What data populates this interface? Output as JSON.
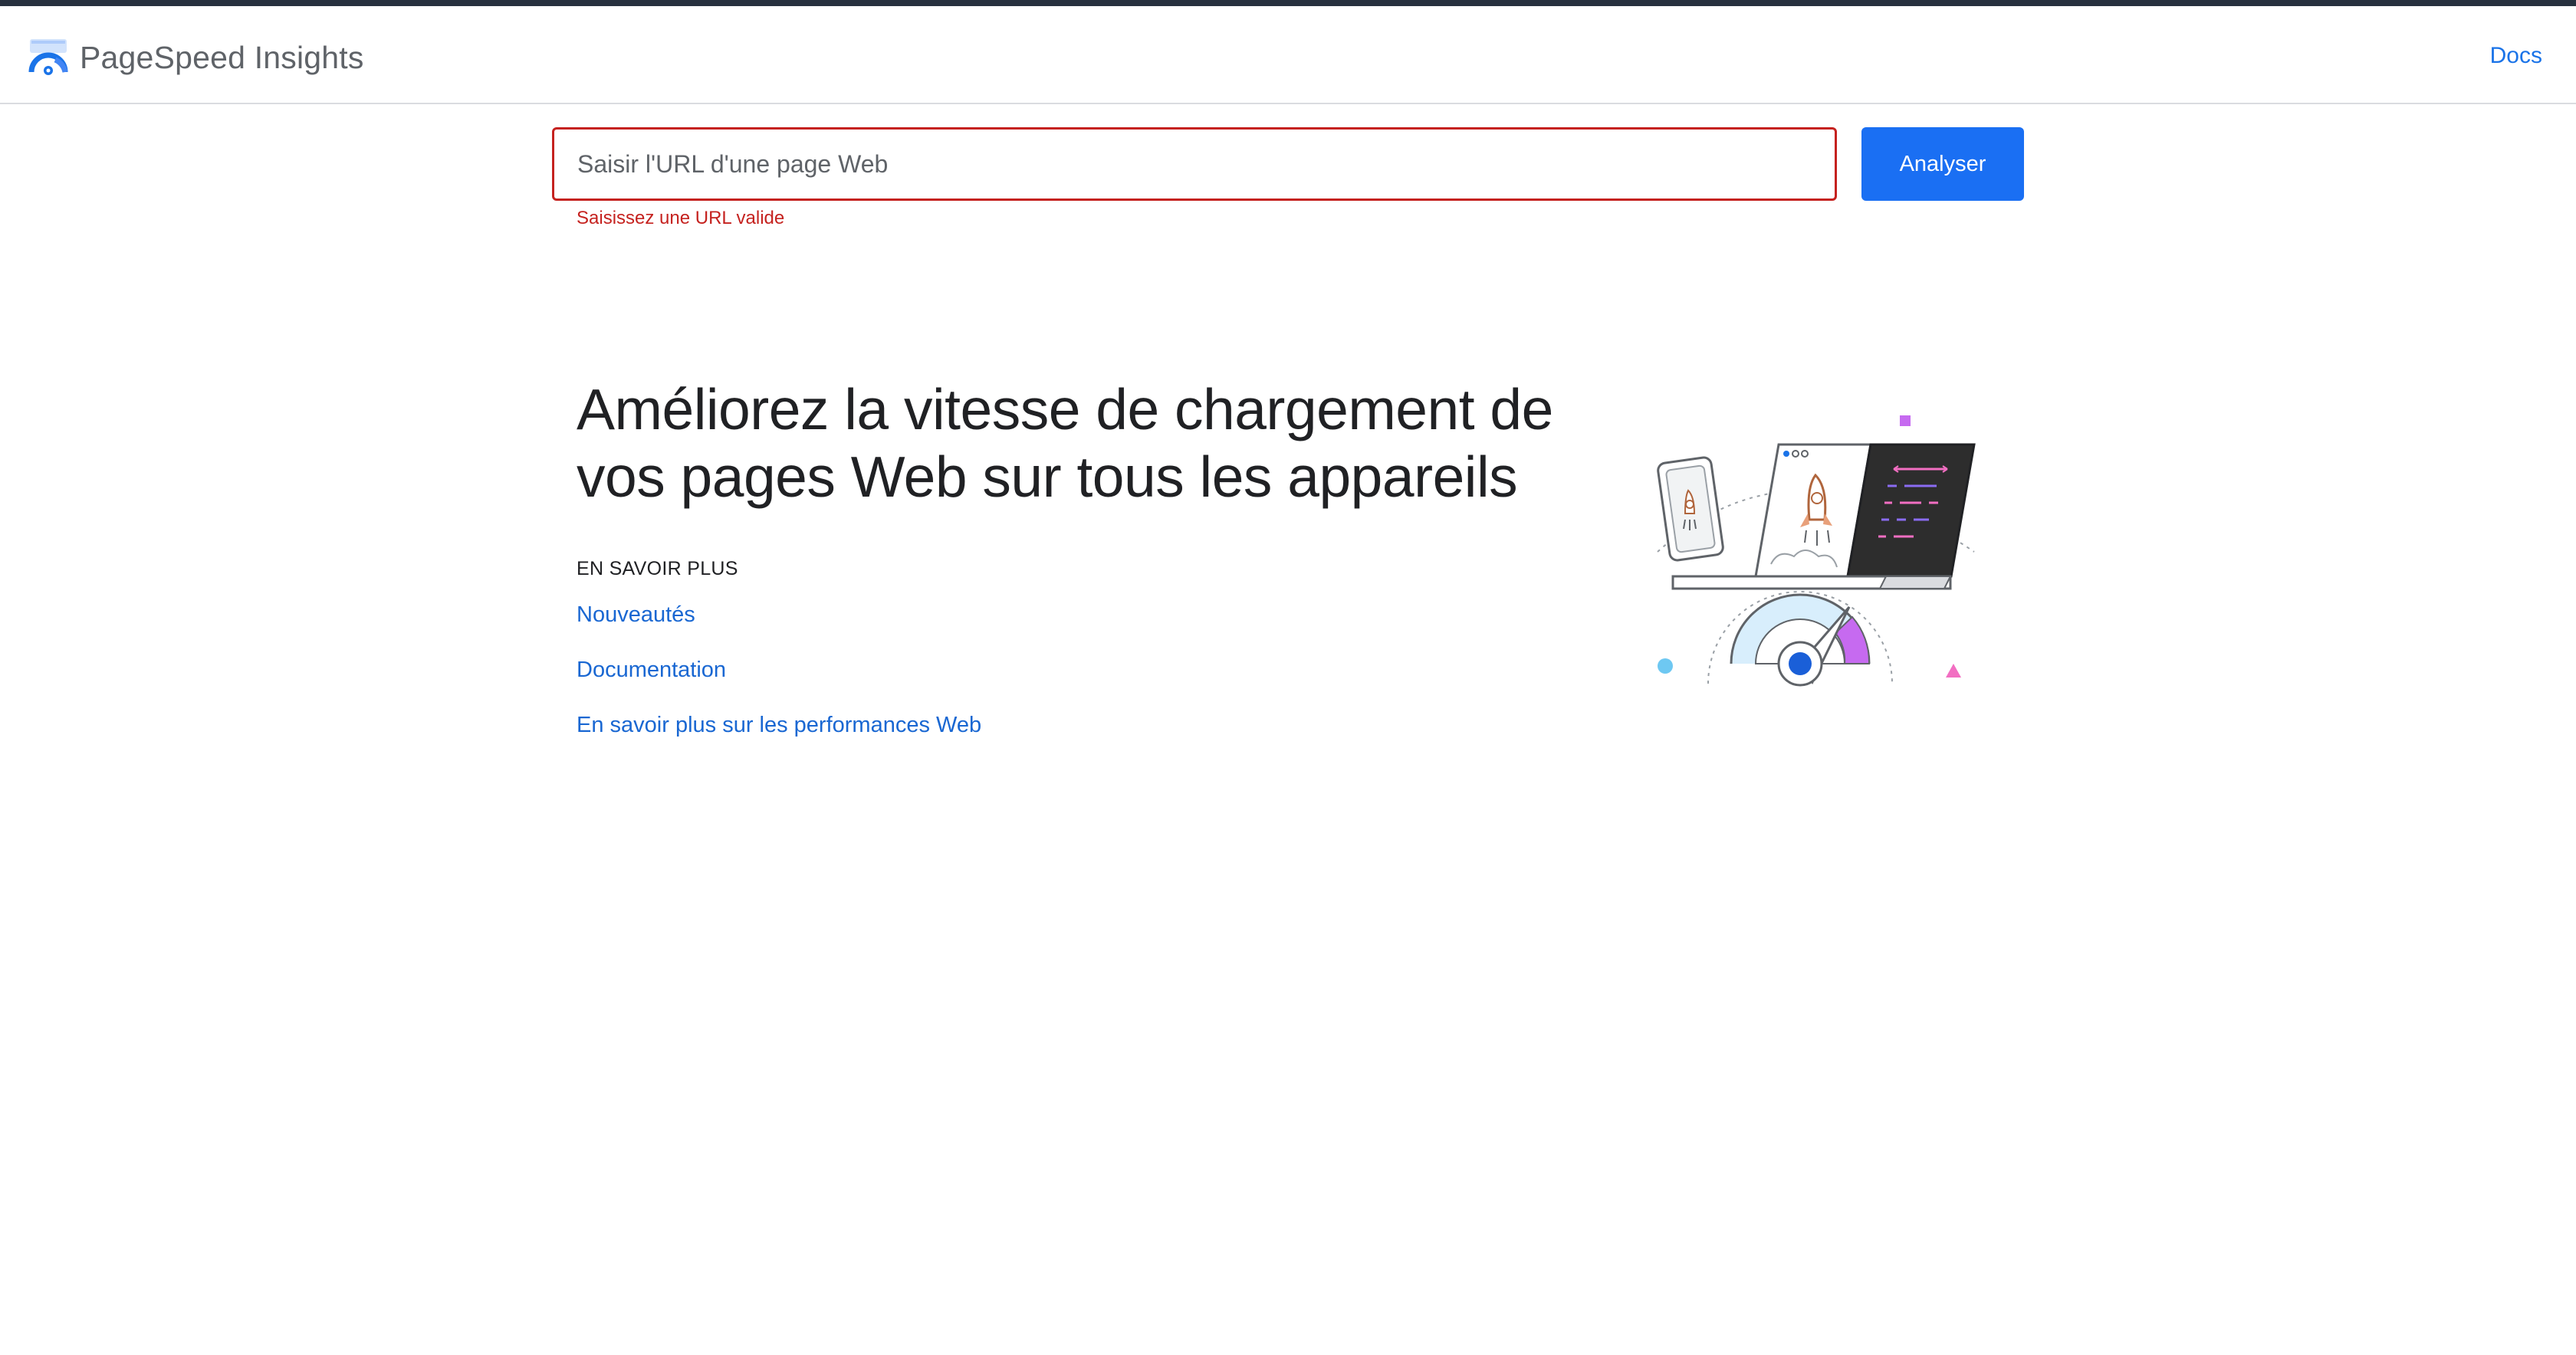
{
  "header": {
    "app_name": "PageSpeed Insights",
    "docs_label": "Docs"
  },
  "search": {
    "placeholder": "Saisir l'URL d'une page Web",
    "value": "",
    "error": "Saisissez une URL valide",
    "analyze_label": "Analyser"
  },
  "main": {
    "headline": "Améliorez la vitesse de chargement de vos pages Web sur tous les appareils",
    "learn_more_heading": "EN SAVOIR PLUS",
    "links": [
      {
        "label": "Nouveautés"
      },
      {
        "label": "Documentation"
      },
      {
        "label": "En savoir plus sur les performances Web"
      }
    ]
  },
  "colors": {
    "accent": "#1a6ff3",
    "link": "#1967d2",
    "error": "#c5221f",
    "topbar": "#27313e"
  },
  "icons": {
    "brand": "pagespeed-logo-icon",
    "illustration": "devices-speed-gauge-illustration"
  }
}
